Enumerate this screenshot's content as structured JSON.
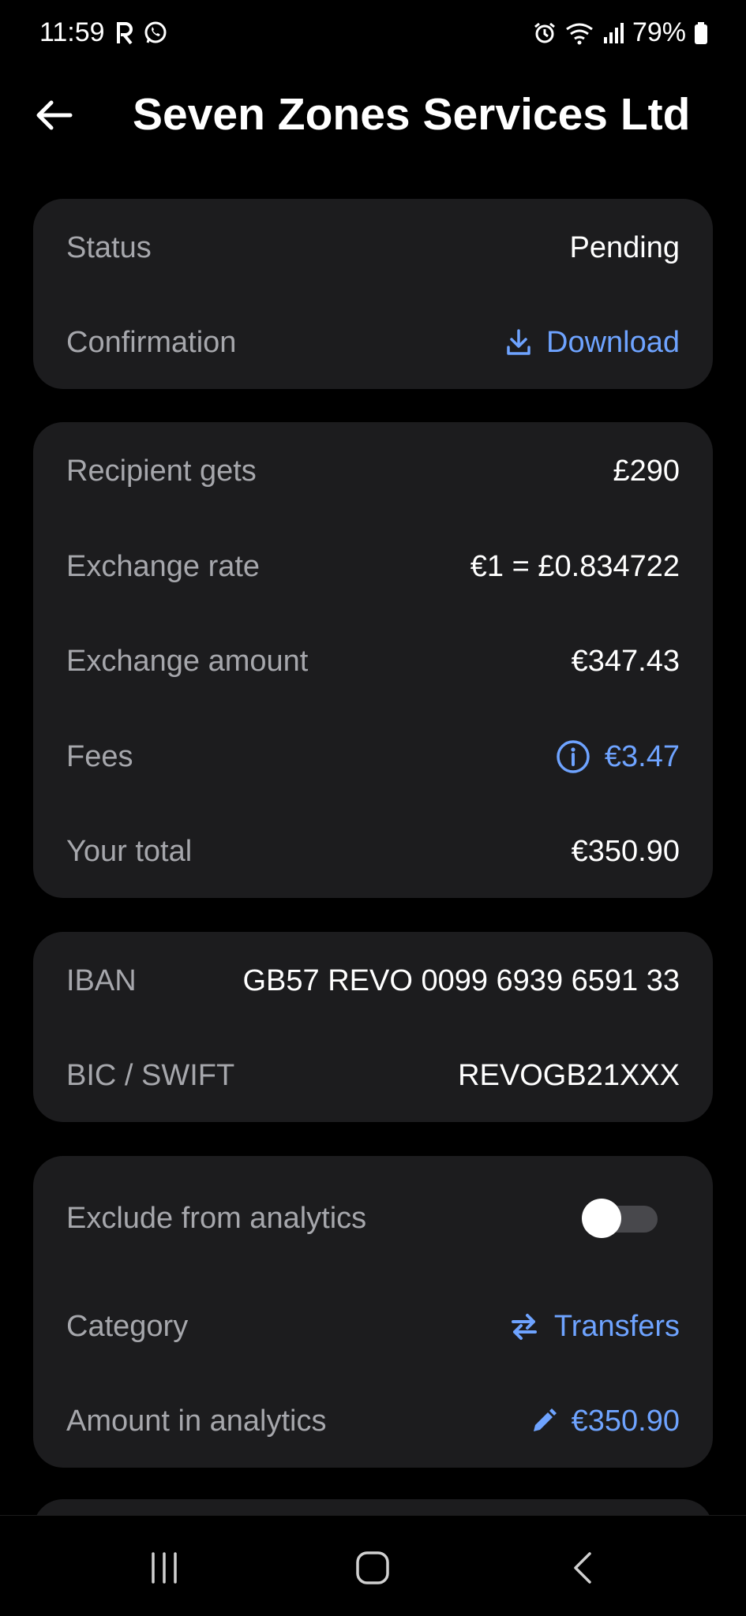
{
  "status_bar": {
    "time": "11:59",
    "battery": "79%",
    "icons": [
      "revolut-icon",
      "whatsapp-icon",
      "alarm-icon",
      "wifi-icon",
      "signal-icon",
      "battery-icon"
    ]
  },
  "header": {
    "title": "Seven Zones Services Ltd",
    "back_icon": "arrow-left-icon"
  },
  "status_card": {
    "status_label": "Status",
    "status_value": "Pending",
    "confirmation_label": "Confirmation",
    "confirmation_action": "Download"
  },
  "amounts_card": {
    "recipient_label": "Recipient gets",
    "recipient_value": "£290",
    "rate_label": "Exchange rate",
    "rate_value": "€1 = £0.834722",
    "exchange_label": "Exchange amount",
    "exchange_value": "€347.43",
    "fees_label": "Fees",
    "fees_value": "€3.47",
    "total_label": "Your total",
    "total_value": "€350.90"
  },
  "bank_card": {
    "iban_label": "IBAN",
    "iban_value": "GB57 REVO 0099 6939 6591 33",
    "bic_label": "BIC / SWIFT",
    "bic_value": "REVOGB21XXX"
  },
  "analytics_card": {
    "exclude_label": "Exclude from analytics",
    "exclude_enabled": false,
    "category_label": "Category",
    "category_value": "Transfers",
    "amount_label": "Amount in analytics",
    "amount_value": "€350.90"
  },
  "colors": {
    "background": "#000000",
    "card": "#1c1c1e",
    "label": "#a6a7ac",
    "accent": "#6ea3ff"
  }
}
